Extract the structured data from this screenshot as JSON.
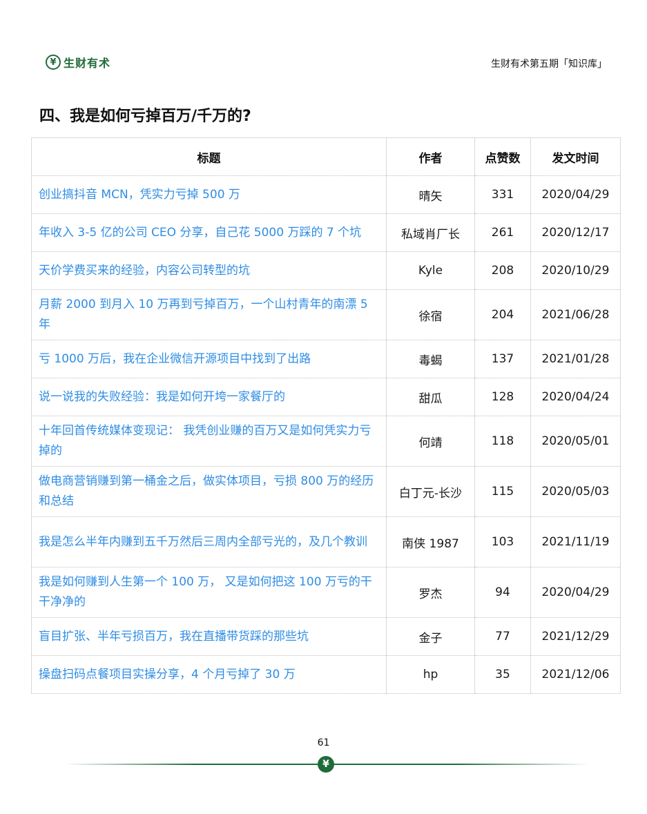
{
  "header": {
    "logo_text": "生财有术",
    "logo_glyph": "¥",
    "right_text": "生财有术第五期「知识库」"
  },
  "section_title": "四、我是如何亏掉百万/千万的?",
  "table": {
    "headers": [
      "标题",
      "作者",
      "点赞数",
      "发文时间"
    ],
    "rows": [
      {
        "title": "创业搞抖音 MCN，凭实力亏掉 500 万",
        "author": "晴矢",
        "likes": "331",
        "date": "2020/04/29"
      },
      {
        "title": "年收入 3-5 亿的公司 CEO 分享，自己花 5000 万踩的 7 个坑",
        "author": "私域肖厂长",
        "likes": "261",
        "date": "2020/12/17"
      },
      {
        "title": "天价学费买来的经验，内容公司转型的坑",
        "author": "Kyle",
        "likes": "208",
        "date": "2020/10/29"
      },
      {
        "title": "月薪 2000 到月入 10 万再到亏掉百万，一个山村青年的南漂 5 年",
        "author": "徐宿",
        "likes": "204",
        "date": "2021/06/28"
      },
      {
        "title": "亏 1000 万后，我在企业微信开源项目中找到了出路",
        "author": "毒蝎",
        "likes": "137",
        "date": "2021/01/28"
      },
      {
        "title": "说一说我的失败经验：我是如何开垮一家餐厅的",
        "author": "甜瓜",
        "likes": "128",
        "date": "2020/04/24"
      },
      {
        "title": "十年回首传统媒体变现记： 我凭创业赚的百万又是如何凭实力亏掉的",
        "author": "何靖",
        "likes": "118",
        "date": "2020/05/01"
      },
      {
        "title": "做电商营销赚到第一桶金之后，做实体项目，亏损 800 万的经历和总结",
        "author": "白丁元-长沙",
        "likes": "115",
        "date": "2020/05/03"
      },
      {
        "title": "我是怎么半年内赚到五千万然后三周内全部亏光的，及几个教训",
        "author": "南侠 1987",
        "likes": "103",
        "date": "2021/11/19"
      },
      {
        "title": "我是如何赚到人生第一个 100 万， 又是如何把这 100 万亏的干干净净的",
        "author": "罗杰",
        "likes": "94",
        "date": "2020/04/29"
      },
      {
        "title": "盲目扩张、半年亏损百万，我在直播带货踩的那些坑",
        "author": "金子",
        "likes": "77",
        "date": "2021/12/29"
      },
      {
        "title": "操盘扫码点餐项目实操分享，4 个月亏掉了 30 万",
        "author": "hp",
        "likes": "35",
        "date": "2021/12/06"
      }
    ]
  },
  "footer": {
    "page_number": "61",
    "mark_glyph": "¥"
  },
  "colors": {
    "brand_green": "#1f6b3a",
    "link_blue": "#2f8de4"
  }
}
